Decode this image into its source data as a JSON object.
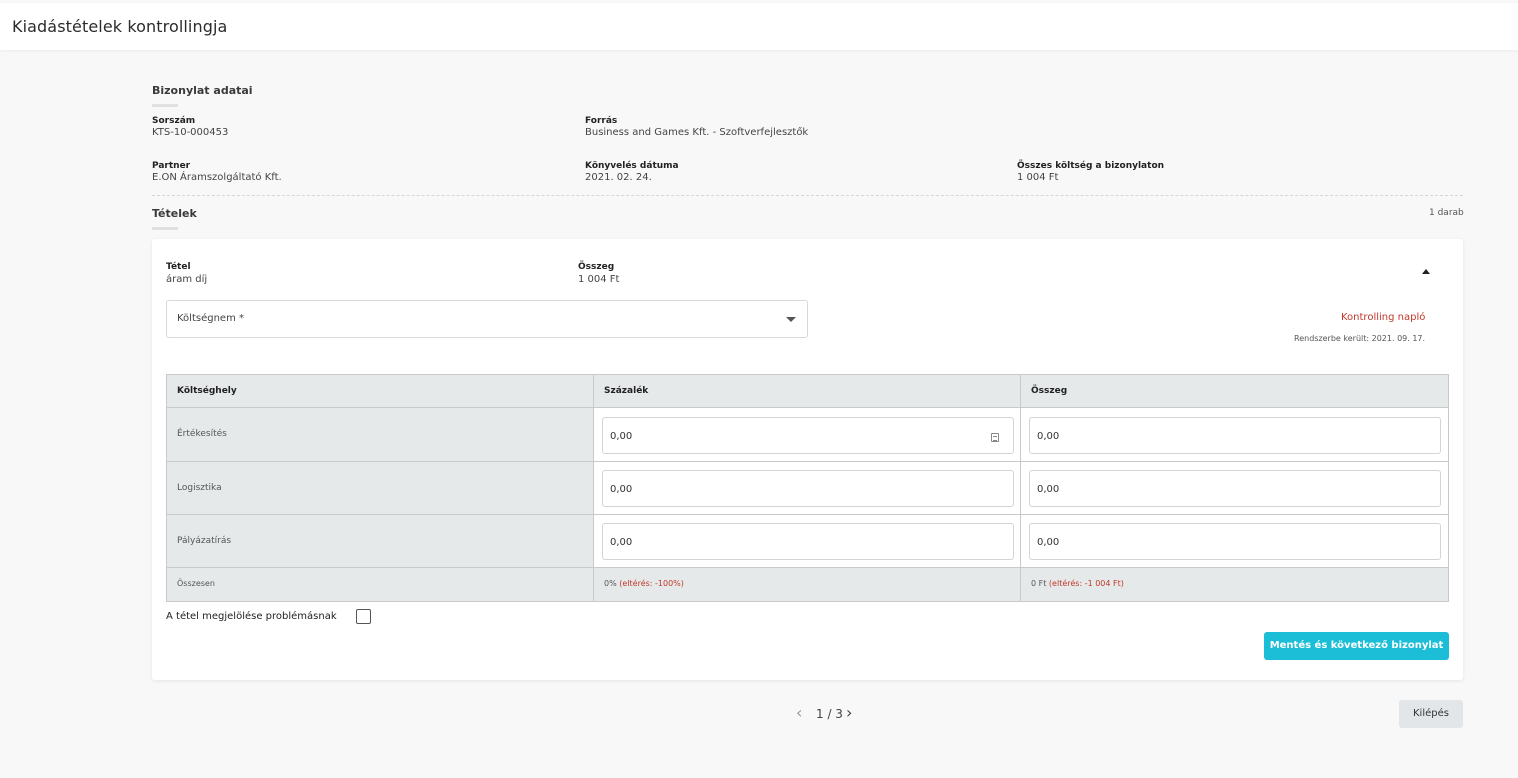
{
  "header": {
    "title": "Kiadástételek kontrollingja"
  },
  "document": {
    "section_title": "Bizonylat adatai",
    "serial_label": "Sorszám",
    "serial_value": "KTS-10-000453",
    "source_label": "Forrás",
    "source_value": "Business and Games Kft. - Szoftverfejlesztők",
    "partner_label": "Partner",
    "partner_value": "E.ON Áramszolgáltató Kft.",
    "booking_date_label": "Könyvelés dátuma",
    "booking_date_value": "2021. 02. 24.",
    "total_cost_label": "Összes költség a bizonylaton",
    "total_cost_value": "1 004 Ft"
  },
  "items": {
    "section_title": "Tételek",
    "count": "1 darab",
    "item": {
      "name_label": "Tétel",
      "name_value": "áram díj",
      "amount_label": "Összeg",
      "amount_value": "1 004 Ft",
      "cost_type_placeholder": "Költségnem *",
      "log_link": "Kontrolling napló",
      "registered": "Rendszerbe került: 2021. 09. 17.",
      "table": {
        "headers": [
          "Költséghely",
          "Százalék",
          "Összeg"
        ],
        "rows": [
          {
            "name": "Értékesítés",
            "percent": "0,00",
            "amount": "0,00"
          },
          {
            "name": "Logisztika",
            "percent": "0,00",
            "amount": "0,00"
          },
          {
            "name": "Pályázatírás",
            "percent": "0,00",
            "amount": "0,00"
          }
        ],
        "total": {
          "label": "Összesen",
          "percent": "0%",
          "percent_diff": "(eltérés: -100%)",
          "amount": "0 Ft",
          "amount_diff": "(eltérés: -1 004 Ft)"
        }
      },
      "problem_label": "A tétel megjelölése problémásnak",
      "save_button": "Mentés és következő bizonylat"
    }
  },
  "pager": {
    "text": "1 / 3"
  },
  "exit_button": "Kilépés",
  "colors": {
    "accent": "#1cbed7",
    "danger": "#c0392b"
  }
}
